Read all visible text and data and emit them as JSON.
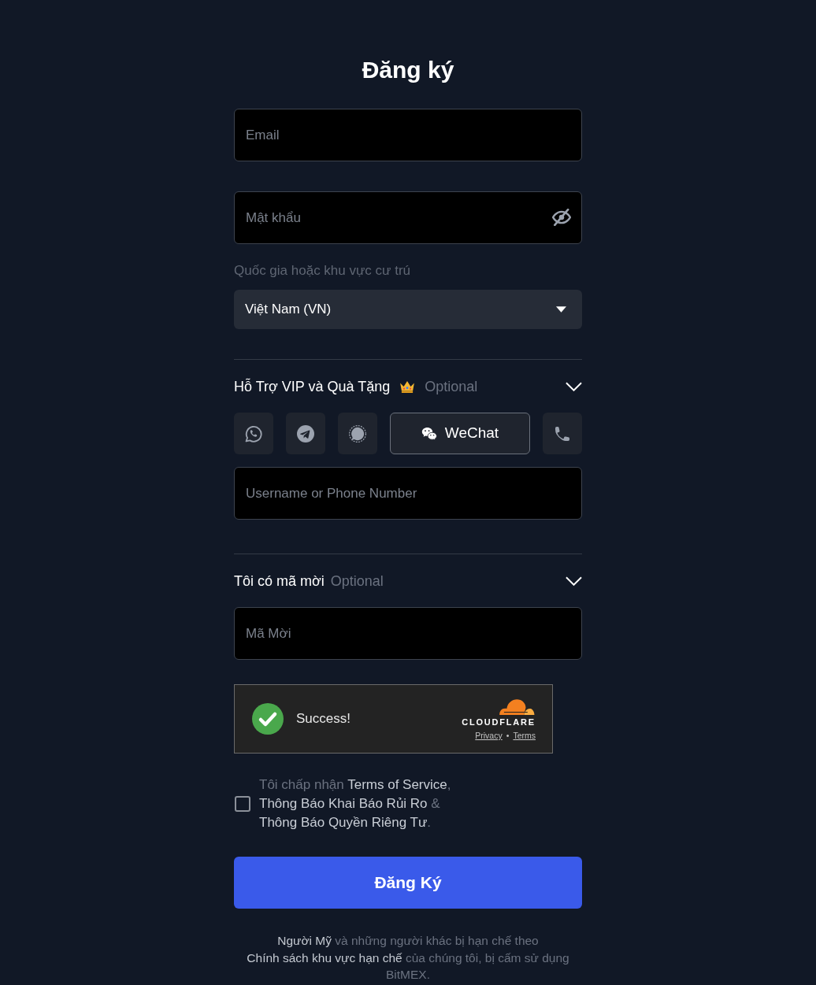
{
  "title": "Đăng ký",
  "email_field": {
    "placeholder": "Email"
  },
  "password_field": {
    "placeholder": "Mật khẩu"
  },
  "country": {
    "label": "Quốc gia hoặc khu vực cư trú",
    "value": "Việt Nam (VN)"
  },
  "vip_section": {
    "title": "Hỗ Trợ VIP và Quà Tặng",
    "optional": "Optional",
    "expanded": true,
    "channels": [
      {
        "kind": "whatsapp",
        "selected": false
      },
      {
        "kind": "telegram",
        "selected": false
      },
      {
        "kind": "signal",
        "selected": false
      },
      {
        "kind": "wechat",
        "label": "WeChat",
        "selected": true
      },
      {
        "kind": "phone",
        "selected": false
      }
    ],
    "contact_field": {
      "placeholder": "Username or Phone Number"
    }
  },
  "referral_section": {
    "title": "Tôi có mã mời",
    "optional": "Optional",
    "expanded": true,
    "code_field": {
      "placeholder": "Mã Mời"
    }
  },
  "captcha": {
    "verified": true,
    "status": "Success!",
    "brand": "CLOUDFLARE",
    "links": [
      "Privacy",
      "Terms"
    ],
    "separator": "•"
  },
  "terms": {
    "checked": false,
    "parts": [
      {
        "kind": "text",
        "text": "Tôi chấp nhận "
      },
      {
        "kind": "link",
        "text": "Terms of Service"
      },
      {
        "kind": "text",
        "text": ", "
      },
      {
        "kind": "link",
        "text": "Thông Báo Khai Báo Rủi Ro"
      },
      {
        "kind": "text",
        "text": " & "
      },
      {
        "kind": "link",
        "text": "Thông Báo Quyền Riêng Tư"
      },
      {
        "kind": "text",
        "text": "."
      }
    ]
  },
  "submit_button": {
    "label": "Đăng Ký"
  },
  "footer": {
    "parts": [
      {
        "kind": "link",
        "text": "Người Mỹ"
      },
      {
        "kind": "text",
        "text": " và những người khác bị hạn chế theo "
      },
      {
        "kind": "link",
        "text": "Chính sách khu vực hạn chế"
      },
      {
        "kind": "text",
        "text": " của chúng tôi, bị cấm sử dụng BitMEX."
      }
    ]
  }
}
